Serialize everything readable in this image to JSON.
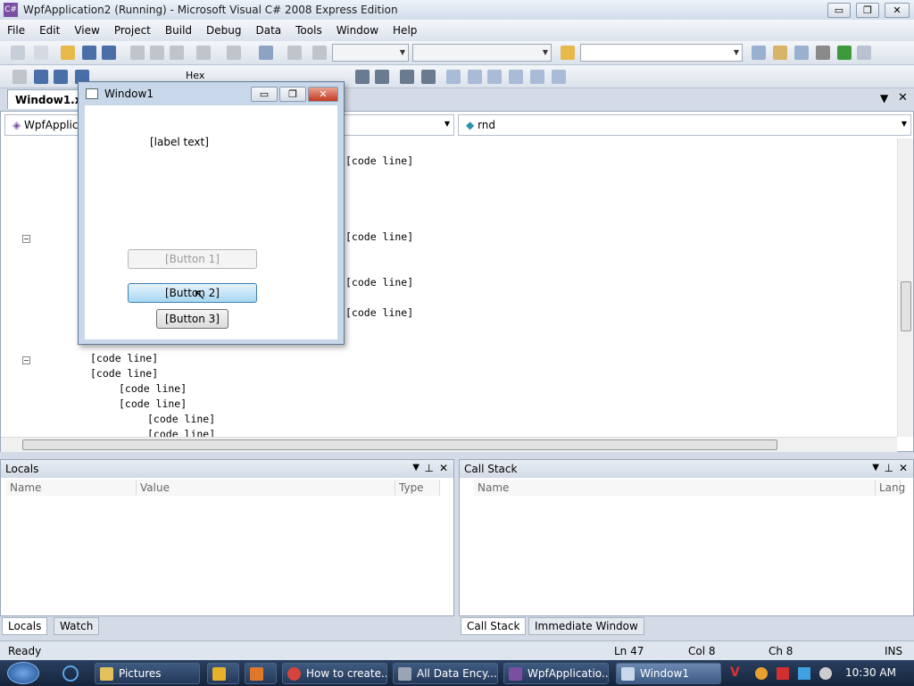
{
  "window": {
    "title": "WpfApplication2 (Running) - Microsoft Visual C# 2008 Express Edition",
    "icon": "csharp-app-icon"
  },
  "caption_buttons": {
    "minimize": "▭",
    "maximize": "❐",
    "close": "✕"
  },
  "menu": [
    "File",
    "Edit",
    "View",
    "Project",
    "Build",
    "Debug",
    "Data",
    "Tools",
    "Window",
    "Help"
  ],
  "toolbar2": {
    "hex_label": "Hex"
  },
  "document_tab": {
    "label": "Window1.xa"
  },
  "editor": {
    "class_combo": "WpfApplica",
    "member_combo": "rnd",
    "code_lines": [
      {
        "text": "[code line]"
      },
      {
        "text": "[code line]"
      },
      {
        "text": "[code line]"
      },
      {
        "text": "[code line]"
      },
      {
        "text": "[code line]"
      },
      {
        "text": "[code line]"
      },
      {
        "text": "[code line]"
      },
      {
        "text": "[code line]"
      },
      {
        "text": "[code line]"
      },
      {
        "text": "[code line]"
      },
      {
        "text": "[code line]"
      },
      {
        "text": "[code line]"
      },
      {
        "text": "[code line]"
      }
    ]
  },
  "locals_pane": {
    "title": "Locals",
    "columns": [
      "Name",
      "Value",
      "Type"
    ]
  },
  "callstack_pane": {
    "title": "Call Stack",
    "columns": [
      "Name",
      "Lang"
    ]
  },
  "bottom_tabs_left": [
    "Locals",
    "Watch"
  ],
  "bottom_tabs_right": [
    "Call Stack",
    "Immediate Window"
  ],
  "status": {
    "ready": "Ready",
    "ln": "Ln 47",
    "col": "Col 8",
    "ch": "Ch 8",
    "ins": "INS"
  },
  "wpf_window": {
    "title": "Window1",
    "label": "[label text]",
    "button1": "[Button 1]",
    "button2": "[Button 2]",
    "button3": "[Button 3]"
  },
  "taskbar": {
    "items": [
      "Pictures",
      "",
      "",
      "How to create...",
      "All Data Ency...",
      "WpfApplicatio...",
      "Window1"
    ],
    "clock": "10:30 AM"
  },
  "colors": {
    "keyword": "#0000ff",
    "type": "#2b91af",
    "string": "#a31515",
    "taskbar": "#1f3350"
  }
}
